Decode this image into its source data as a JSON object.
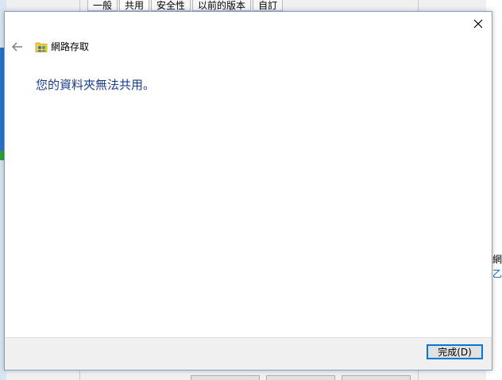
{
  "background_window": {
    "tabs": [
      {
        "label": "一般",
        "active": false
      },
      {
        "label": "共用",
        "active": true
      },
      {
        "label": "安全性",
        "active": false
      },
      {
        "label": "以前的版本",
        "active": false
      },
      {
        "label": "自訂",
        "active": false
      }
    ],
    "right_fragment_1": "網",
    "right_fragment_2": "乙"
  },
  "dialog": {
    "title": "網路存取",
    "message": "您的資料夾無法共用。",
    "finish_button_label": "完成(D)",
    "close_icon": "close-icon",
    "back_icon": "back-arrow-icon",
    "title_icon": "network-folder-icon"
  },
  "colors": {
    "message_text": "#1c3d8c",
    "accent": "#0078d7",
    "footer_bg": "#f0f0f0"
  }
}
